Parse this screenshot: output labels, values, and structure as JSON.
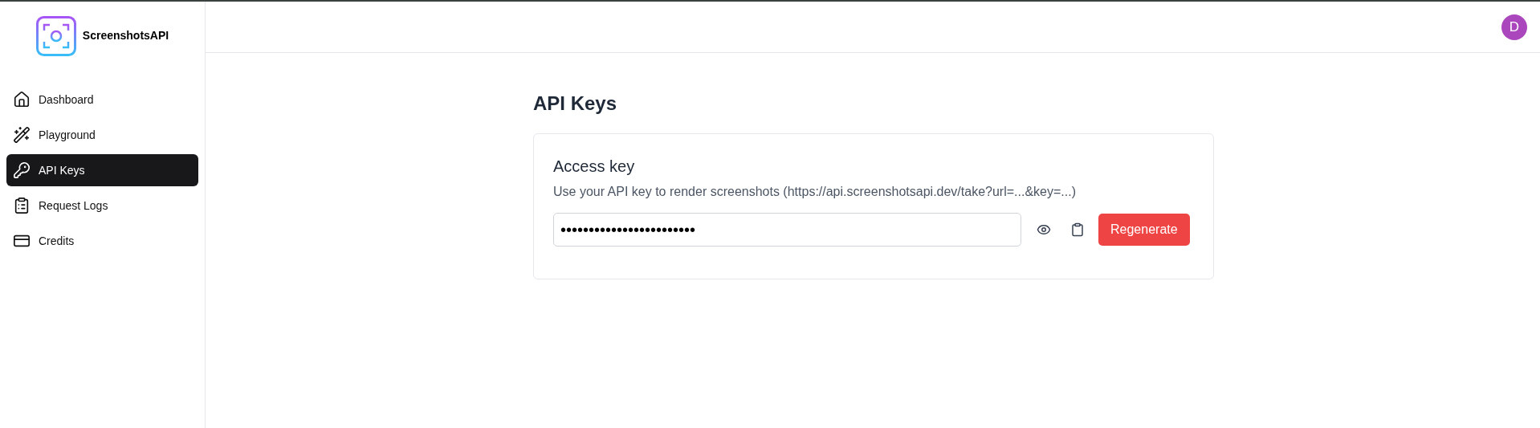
{
  "brand": {
    "name": "ScreenshotsAPI"
  },
  "sidebar": {
    "items": [
      {
        "label": "Dashboard",
        "selected": false
      },
      {
        "label": "Playground",
        "selected": false
      },
      {
        "label": "API Keys",
        "selected": true
      },
      {
        "label": "Request Logs",
        "selected": false
      },
      {
        "label": "Credits",
        "selected": false
      }
    ]
  },
  "header": {
    "avatar": "D"
  },
  "page": {
    "title": "API Keys",
    "card": {
      "title": "Access key",
      "description": "Use your API key to render screenshots (https://api.screenshotsapi.dev/take?url=...&key=...)",
      "key_value": "••••••••••••••••••••••••",
      "button": "Regenerate"
    }
  }
}
